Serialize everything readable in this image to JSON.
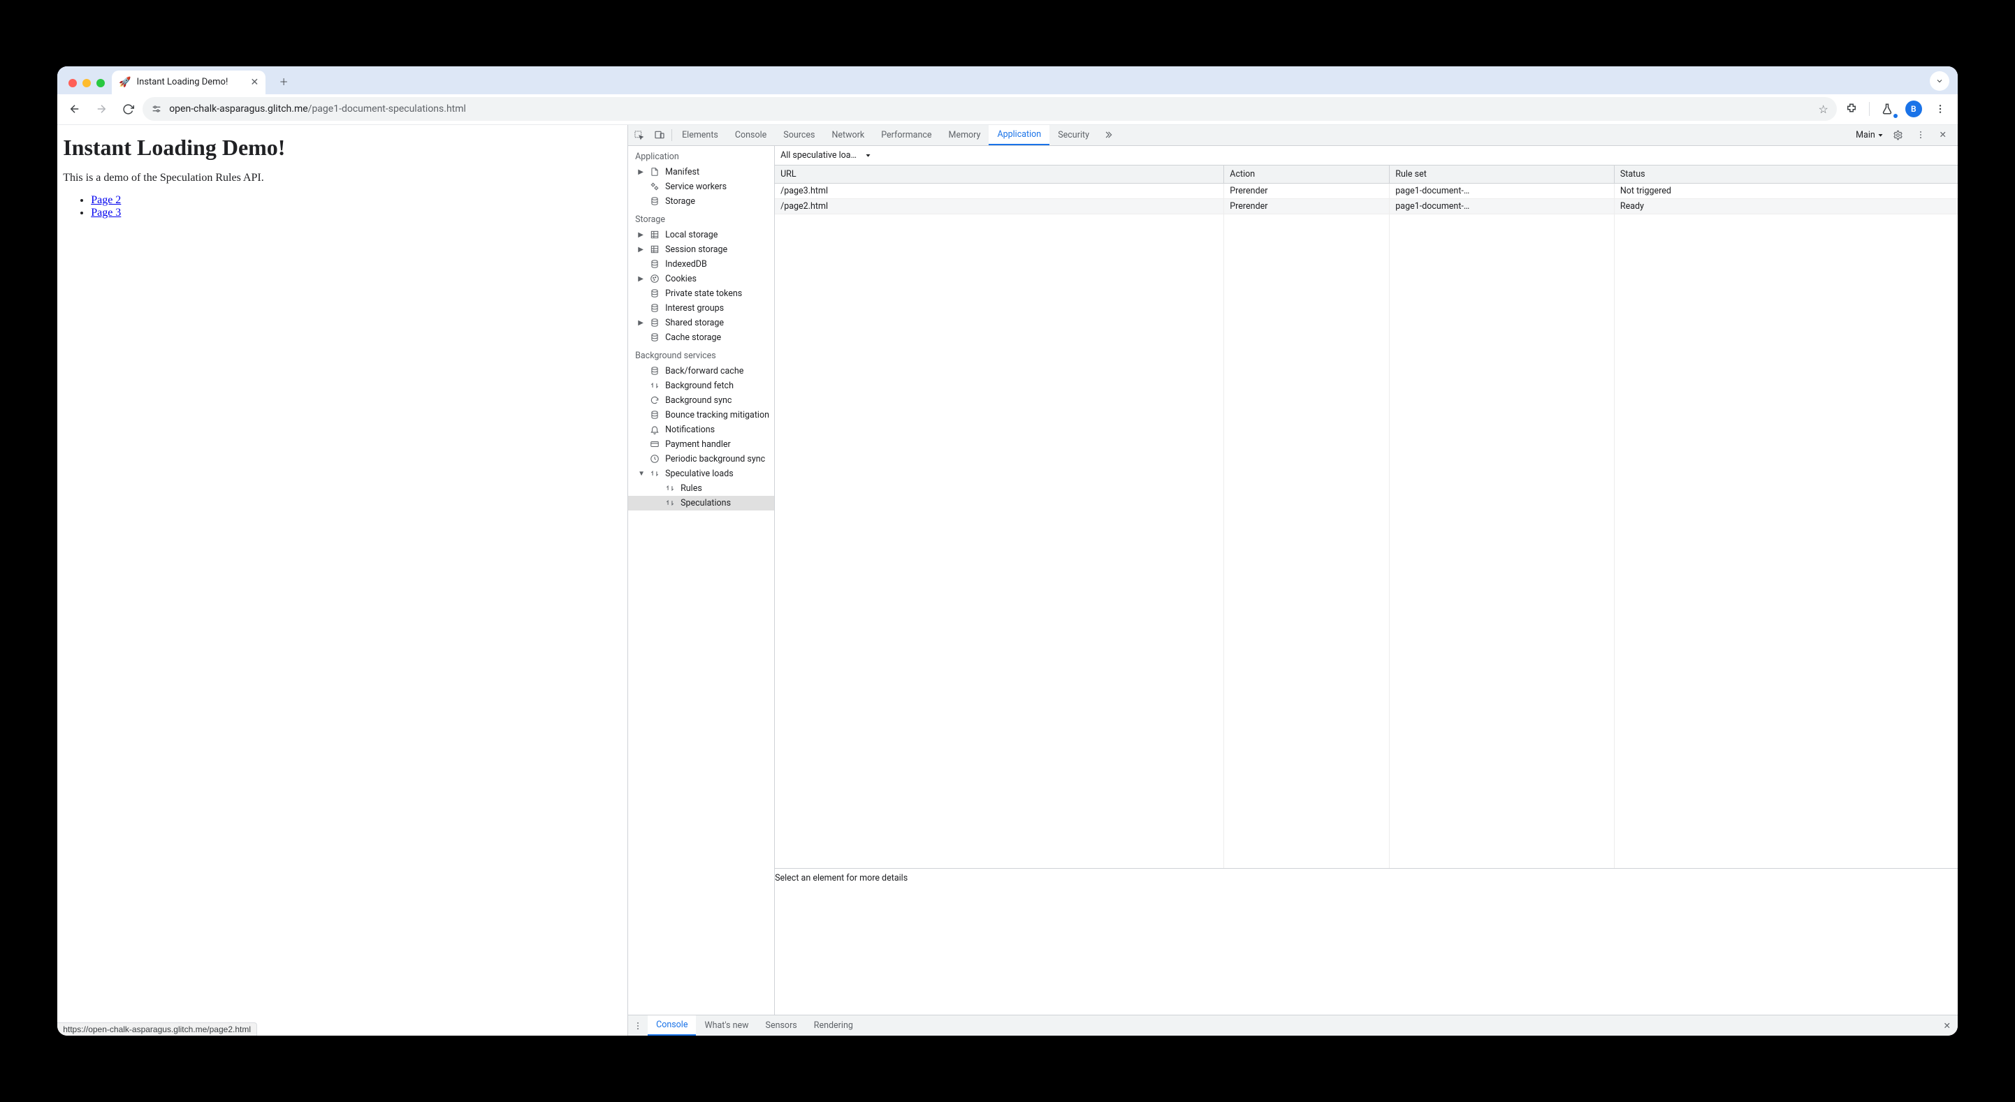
{
  "browser": {
    "tab_title": "Instant Loading Demo!",
    "favicon": "🚀",
    "url_host": "open-chalk-asparagus.glitch.me",
    "url_path": "/page1-document-speculations.html",
    "avatar_letter": "B",
    "status_bar": "https://open-chalk-asparagus.glitch.me/page2.html"
  },
  "page": {
    "heading": "Instant Loading Demo!",
    "intro": "This is a demo of the Speculation Rules API.",
    "links": [
      "Page 2",
      "Page 3"
    ]
  },
  "devtools": {
    "tabs": [
      "Elements",
      "Console",
      "Sources",
      "Network",
      "Performance",
      "Memory",
      "Application",
      "Security"
    ],
    "active_tab": "Application",
    "context_label": "Main",
    "sidebar": {
      "sections": [
        {
          "title": "Application",
          "items": [
            {
              "label": "Manifest",
              "icon": "file",
              "expandable": true
            },
            {
              "label": "Service workers",
              "icon": "gears"
            },
            {
              "label": "Storage",
              "icon": "db"
            }
          ]
        },
        {
          "title": "Storage",
          "items": [
            {
              "label": "Local storage",
              "icon": "grid",
              "expandable": true
            },
            {
              "label": "Session storage",
              "icon": "grid",
              "expandable": true
            },
            {
              "label": "IndexedDB",
              "icon": "db"
            },
            {
              "label": "Cookies",
              "icon": "cookie",
              "expandable": true
            },
            {
              "label": "Private state tokens",
              "icon": "db"
            },
            {
              "label": "Interest groups",
              "icon": "db"
            },
            {
              "label": "Shared storage",
              "icon": "db",
              "expandable": true
            },
            {
              "label": "Cache storage",
              "icon": "db"
            }
          ]
        },
        {
          "title": "Background services",
          "items": [
            {
              "label": "Back/forward cache",
              "icon": "db"
            },
            {
              "label": "Background fetch",
              "icon": "swap"
            },
            {
              "label": "Background sync",
              "icon": "sync"
            },
            {
              "label": "Bounce tracking mitigation",
              "icon": "db"
            },
            {
              "label": "Notifications",
              "icon": "bell"
            },
            {
              "label": "Payment handler",
              "icon": "card"
            },
            {
              "label": "Periodic background sync",
              "icon": "clock"
            },
            {
              "label": "Speculative loads",
              "icon": "swap",
              "expandable": true,
              "expanded": true,
              "children": [
                {
                  "label": "Rules",
                  "icon": "swap"
                },
                {
                  "label": "Speculations",
                  "icon": "swap",
                  "selected": true
                }
              ]
            }
          ]
        }
      ]
    },
    "filter_label": "All speculative loa…",
    "table": {
      "columns": [
        "URL",
        "Action",
        "Rule set",
        "Status"
      ],
      "rows": [
        {
          "url": "/page3.html",
          "action": "Prerender",
          "ruleset": "page1-document-…",
          "status": "Not triggered"
        },
        {
          "url": "/page2.html",
          "action": "Prerender",
          "ruleset": "page1-document-…",
          "status": "Ready"
        }
      ]
    },
    "detail_placeholder": "Select an element for more details",
    "drawer_tabs": [
      "Console",
      "What's new",
      "Sensors",
      "Rendering"
    ],
    "drawer_active": "Console"
  }
}
